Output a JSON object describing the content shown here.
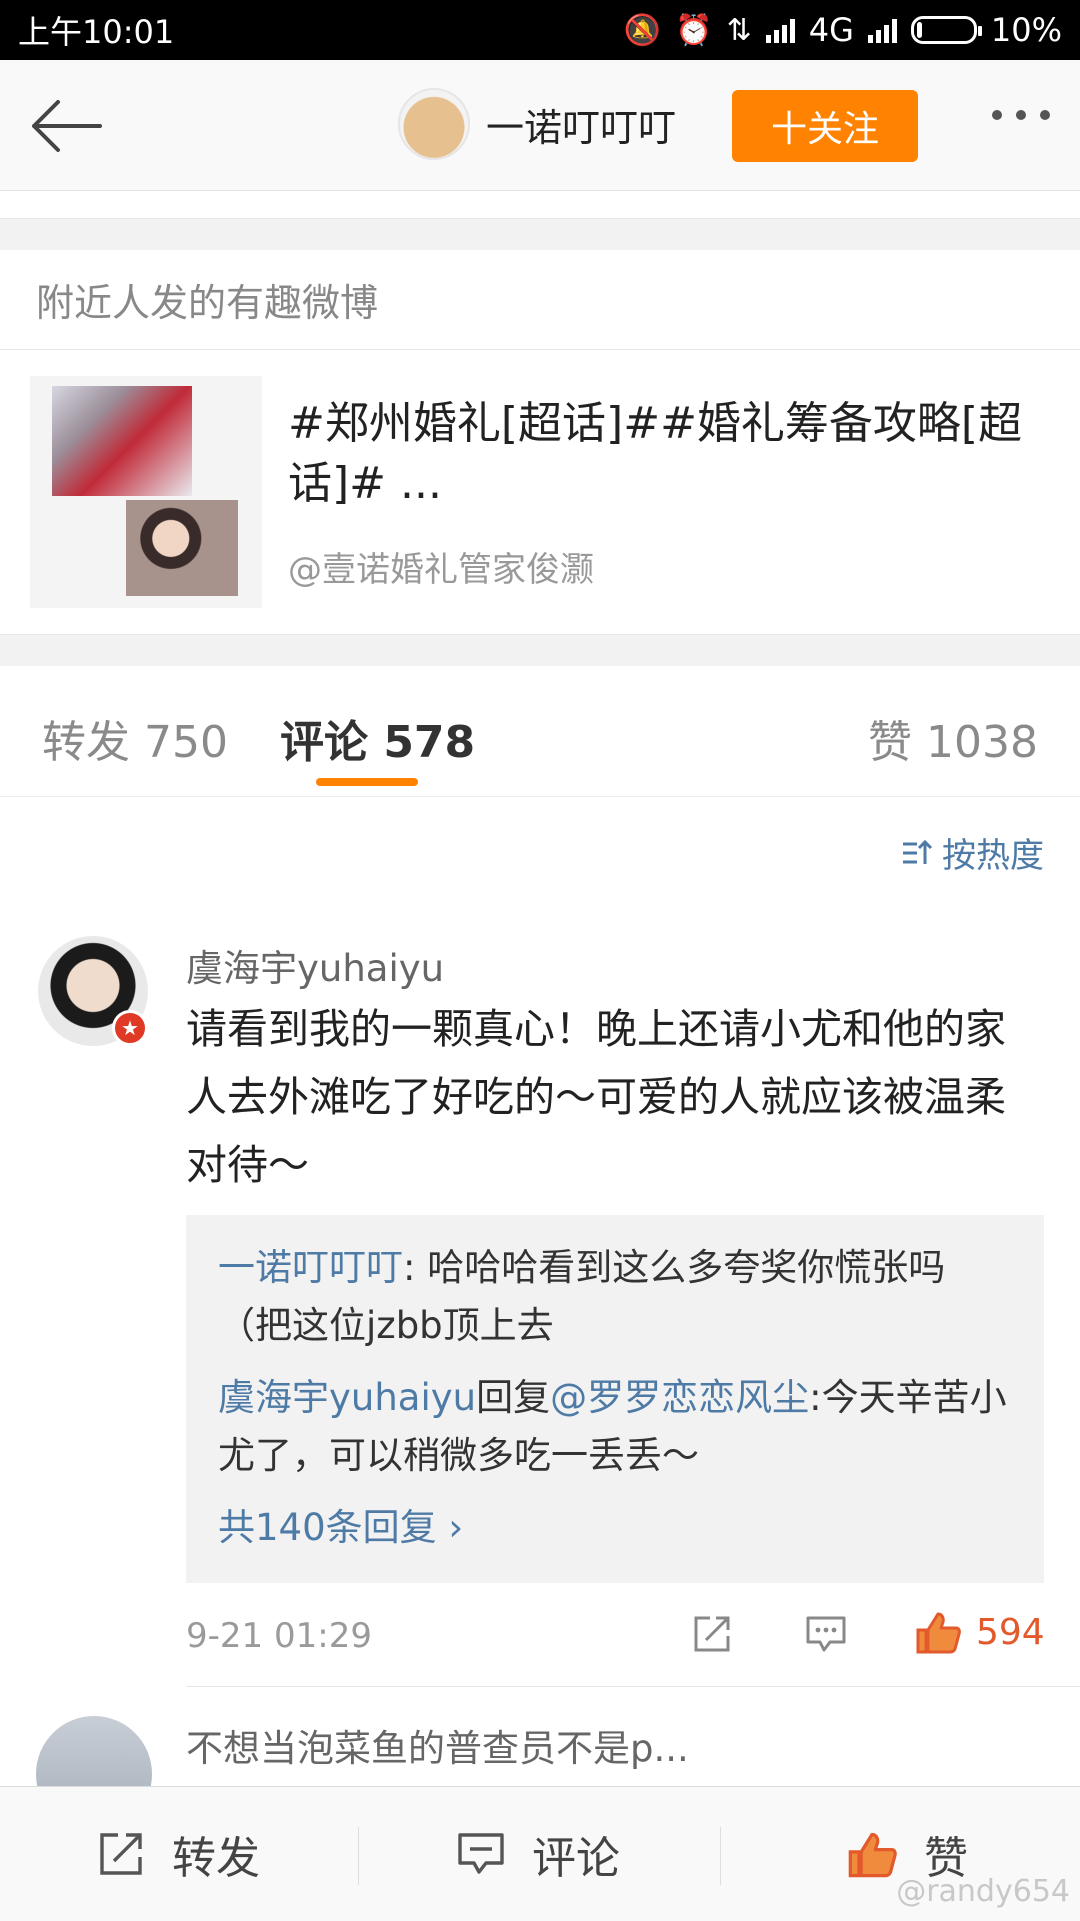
{
  "status_bar": {
    "time": "上午10:01",
    "network": "4G",
    "battery": "10%",
    "battery_level": 0.1
  },
  "nav": {
    "username": "一诺叮叮叮",
    "follow_label": "十关注"
  },
  "nearby": {
    "header": "附近人发的有趣微博",
    "title": "#郑州婚礼[超话]##婚礼筹备攻略[超话]# ...",
    "source": "@壹诺婚礼管家俊灏"
  },
  "tabs": {
    "repost": "转发 750",
    "comment": "评论 578",
    "like": "赞 1038"
  },
  "sort_label": "按热度",
  "comment": {
    "author": "虞海宇yuhaiyu",
    "text": "请看到我的一颗真心！晚上还请小尤和他的家人去外滩吃了好吃的～可爱的人就应该被温柔对待～",
    "replies": [
      {
        "author": "一诺叮叮叮",
        "sep": ": ",
        "text": "哈哈哈看到这么多夸奖你慌张吗（把这位jzbb顶上去"
      },
      {
        "author": "虞海宇yuhaiyu",
        "mid": "回复",
        "mention": "@罗罗恋恋风尘",
        "sep": ":",
        "text": "今天辛苦小尤了，可以稍微多吃一丢丢～"
      }
    ],
    "more_replies": "共140条回复",
    "time": "9-21 01:29",
    "likes": "594"
  },
  "comment2": {
    "author": "不想当泡菜鱼的普查员不是p..."
  },
  "bottom": {
    "repost": "转发",
    "comment": "评论",
    "like": "赞"
  },
  "watermark": "@randy654",
  "colors": {
    "accent": "#ff8200",
    "link": "#4e7aa6",
    "like": "#e25a2c"
  }
}
